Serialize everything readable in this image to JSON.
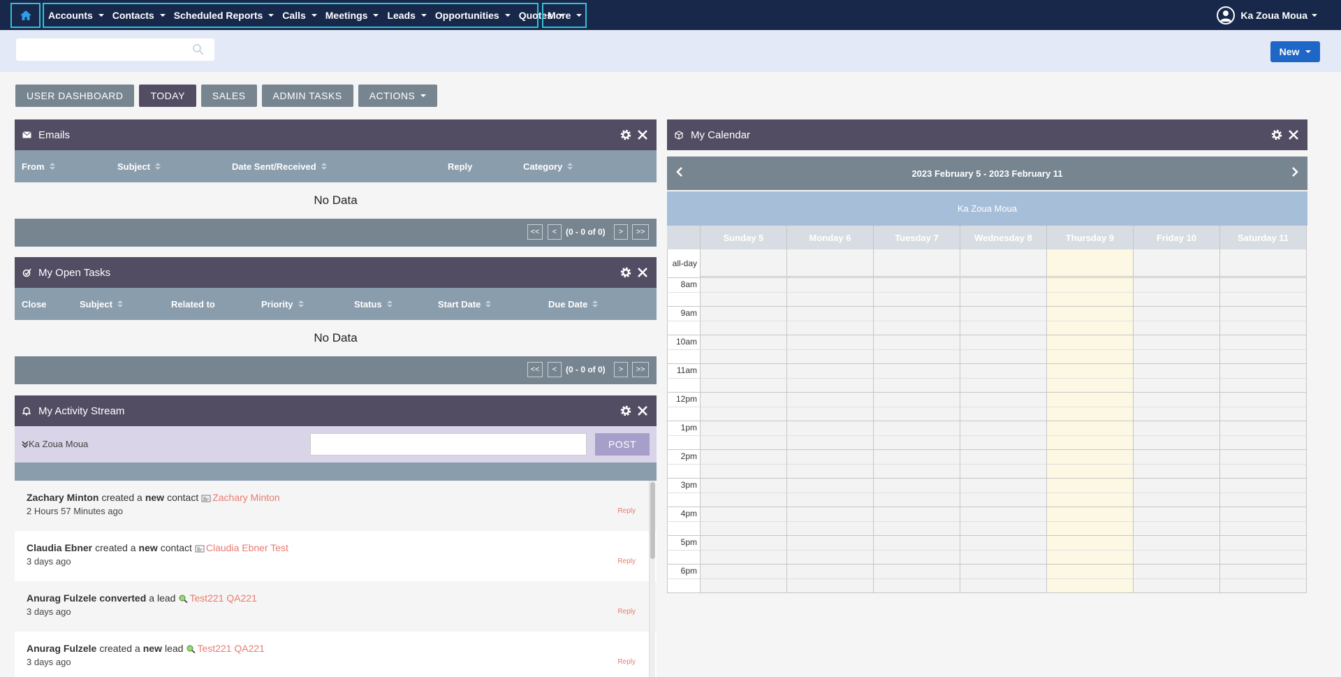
{
  "nav": {
    "items": [
      {
        "label": "Accounts"
      },
      {
        "label": "Contacts"
      },
      {
        "label": "Scheduled Reports"
      },
      {
        "label": "Calls"
      },
      {
        "label": "Meetings"
      },
      {
        "label": "Leads"
      },
      {
        "label": "Opportunities"
      },
      {
        "label": "Quotes"
      }
    ],
    "more_label": "More",
    "annotations": [
      "1",
      "2",
      "3"
    ],
    "user_name": "Ka Zoua Moua",
    "highlight_color": "#33c1d6",
    "bar_color": "#17284a"
  },
  "subbar": {
    "search_placeholder": "",
    "new_label": "New"
  },
  "tabs": [
    {
      "label": "USER DASHBOARD",
      "active": false
    },
    {
      "label": "TODAY",
      "active": true
    },
    {
      "label": "SALES",
      "active": false
    },
    {
      "label": "ADMIN TASKS",
      "active": false
    }
  ],
  "actions_label": "ACTIONS",
  "emails": {
    "title": "Emails",
    "columns": [
      "From",
      "Subject",
      "Date Sent/Received",
      "Reply",
      "Category"
    ],
    "empty": "No Data",
    "pager": {
      "first": "<<",
      "prev": "<",
      "range": "(0 - 0 of 0)",
      "next": ">",
      "last": ">>"
    }
  },
  "tasks": {
    "title": "My Open Tasks",
    "columns": [
      "Close",
      "Subject",
      "Related to",
      "Priority",
      "Status",
      "Start Date",
      "Due Date"
    ],
    "empty": "No Data",
    "pager": {
      "first": "<<",
      "prev": "<",
      "range": "(0 - 0 of 0)",
      "next": ">",
      "last": ">>"
    }
  },
  "activity": {
    "title": "My Activity Stream",
    "user": "Ka Zoua Moua",
    "post_label": "POST",
    "reply_label": "Reply",
    "items": [
      {
        "actor": "Zachary Minton",
        "verb": "created a",
        "bold": "new",
        "object": "contact",
        "link": "Zachary Minton",
        "time": "2 Hours 57 Minutes ago",
        "icon": "contact-card-icon"
      },
      {
        "actor": "Claudia Ebner",
        "verb": "created a",
        "bold": "new",
        "object": "contact",
        "link": "Claudia Ebner Test",
        "time": "3 days ago",
        "icon": "contact-card-icon"
      },
      {
        "actor": "Anurag Fulzele",
        "verb": "",
        "bold": "converted",
        "object": "a lead",
        "link": "Test221 QA221",
        "time": "3 days ago",
        "icon": "lead-search-icon"
      },
      {
        "actor": "Anurag Fulzele",
        "verb": "created a",
        "bold": "new",
        "object": "lead",
        "link": "Test221 QA221",
        "time": "3 days ago",
        "icon": "lead-search-icon"
      }
    ]
  },
  "calendar": {
    "title": "My Calendar",
    "range": "2023 February 5 - 2023 February 11",
    "user": "Ka Zoua Moua",
    "days": [
      "Sunday 5",
      "Monday 6",
      "Tuesday 7",
      "Wednesday 8",
      "Thursday 9",
      "Friday 10",
      "Saturday 11"
    ],
    "today_index": 4,
    "allday_label": "all-day",
    "hours": [
      "8am",
      "9am",
      "10am",
      "11am",
      "12pm",
      "1pm",
      "2pm",
      "3pm",
      "4pm",
      "5pm",
      "6pm"
    ]
  }
}
